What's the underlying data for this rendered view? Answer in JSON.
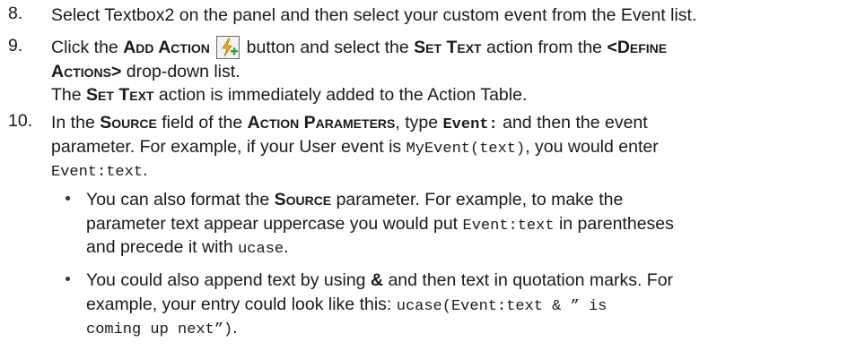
{
  "steps": [
    {
      "number": "8.",
      "text_a": "Select Textbox2 on the panel and then select your custom event from the Event list."
    },
    {
      "number": "9.",
      "t1": "Click the ",
      "add_action": "Add Action",
      "t2": " button and select the ",
      "set_text": "Set Text",
      "t3": " action from the ",
      "define_a": "<Define",
      "define_b": "Actions>",
      "t4": " drop-down list.",
      "note_a": "The ",
      "note_set_text": "Set Text",
      "note_b": " action is immediately added to the Action Table."
    },
    {
      "number": "10.",
      "t1": "In the ",
      "source": "Source",
      "t2": " field of the ",
      "action_params": "Action Parameters",
      "t3": ", type ",
      "event_code": "Event:",
      "t4": " and then the event",
      "t5": "parameter. For example, if your User event is ",
      "myevent_code": "MyEvent(text)",
      "t6": ", you would enter",
      "entry_code": "Event:text",
      "t7": "."
    }
  ],
  "bullets": [
    {
      "t1": "You can also format the ",
      "source": "Source",
      "t2": " parameter. For example, to make the",
      "t3": "parameter text appear uppercase you would put ",
      "code1": "Event:text",
      "t4": " in parentheses",
      "t5": "and precede it with ",
      "code2": "ucase",
      "t6": "."
    },
    {
      "t1": "You could also append text by using ",
      "amp": "&",
      "t2": " and then text in quotation marks. For",
      "t3": "example, your entry could look like this: ",
      "code_a": "ucase(Event:text & ” is",
      "code_b": "coming up next”)",
      "t4": "."
    }
  ],
  "icons": {
    "add_action": "lightning-plus-icon"
  }
}
